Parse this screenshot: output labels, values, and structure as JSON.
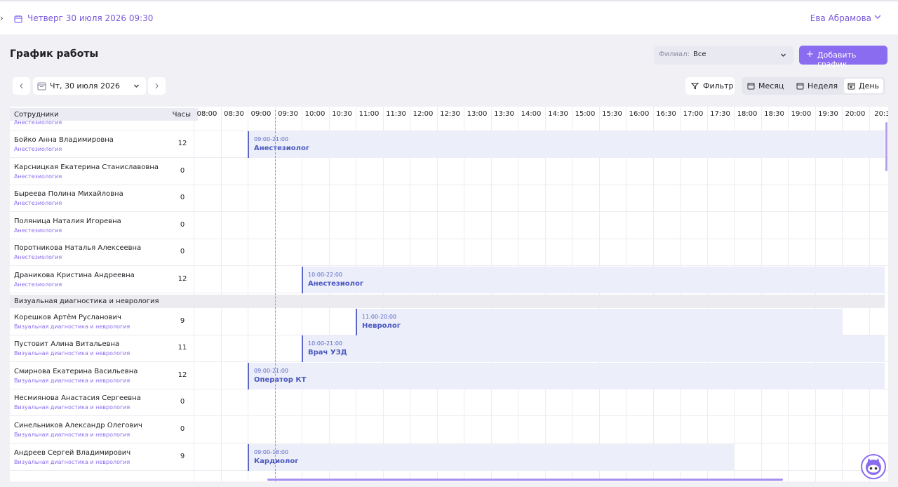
{
  "topbar": {
    "datetime": "Четверг 30 июля 2026 09:30",
    "user": "Ева Абрамова",
    "calendar_icon": "calendar-icon",
    "user_chevron_icon": "chevron-down-icon",
    "expand_icon": "chevron-right-icon"
  },
  "page": {
    "title": "График работы"
  },
  "branch": {
    "label": "Филиал:",
    "value": "Все"
  },
  "add_button": {
    "label": "Добавить график",
    "icon": "plus-icon"
  },
  "date_picker": {
    "value": "Чт, 30 июля 2026"
  },
  "filter": {
    "label": "Фильтр",
    "icon": "filter-icon"
  },
  "views": [
    {
      "label": "Месяц",
      "active": false
    },
    {
      "label": "Неделя",
      "active": false
    },
    {
      "label": "День",
      "active": true
    }
  ],
  "table": {
    "employees_header": "Сотрудники",
    "hours_header": "Часы",
    "partial_dept": "Анестезиология",
    "times": [
      "08:00",
      "08:30",
      "09:00",
      "09:30",
      "10:00",
      "10:30",
      "11:00",
      "11:30",
      "12:00",
      "12:30",
      "13:00",
      "13:30",
      "14:00",
      "14:30",
      "15:00",
      "15:30",
      "16:00",
      "16:30",
      "17:00",
      "17:30",
      "18:00",
      "18:30",
      "19:00",
      "19:30",
      "20:00",
      "20:3"
    ],
    "group1_rows": [
      {
        "name": "Бойко Анна Владимировна",
        "dept": "Анестезиология",
        "hours": "12",
        "shift_time": "09:00-21:00",
        "shift_role": "Анестезиолог",
        "shift_start": "09:00",
        "shift_end": "21:00"
      },
      {
        "name": "Карсницкая Екатерина Станиславовна",
        "dept": "Анестезиология",
        "hours": "0"
      },
      {
        "name": "Быреева Полина Михайловна",
        "dept": "Анестезиология",
        "hours": "0"
      },
      {
        "name": "Поляница Наталия Игоревна",
        "dept": "Анестезиология",
        "hours": "0"
      },
      {
        "name": "Поротникова Наталья Алексеевна",
        "dept": "Анестезиология",
        "hours": "0"
      },
      {
        "name": "Драникова Кристина Андреевна",
        "dept": "Анестезиология",
        "hours": "12",
        "shift_time": "10:00-22:00",
        "shift_role": "Анестезиолог",
        "shift_start": "10:00",
        "shift_end": "22:00"
      }
    ],
    "group2_title": "Визуальная диагностика и неврология",
    "group2_rows": [
      {
        "name": "Корешков Артём Русланович",
        "dept": "Визуальная диагностика и неврология",
        "hours": "9",
        "shift_time": "11:00-20:00",
        "shift_role": "Невролог",
        "shift_start": "11:00",
        "shift_end": "20:00"
      },
      {
        "name": "Пустовит Алина Витальевна",
        "dept": "Визуальная диагностика и неврология",
        "hours": "11",
        "shift_time": "10:00-21:00",
        "shift_role": "Врач УЗД",
        "shift_start": "10:00",
        "shift_end": "21:00"
      },
      {
        "name": "Смирнова Екатерина Васильевна",
        "dept": "Визуальная диагностика и неврология",
        "hours": "12",
        "shift_time": "09:00-21:00",
        "shift_role": "Оператор КТ",
        "shift_start": "09:00",
        "shift_end": "21:00"
      },
      {
        "name": "Несмиянова Анастасия Сергеевна",
        "dept": "Визуальная диагностика и неврология",
        "hours": "0"
      },
      {
        "name": "Синельников Александр Олегович",
        "dept": "Визуальная диагностика и неврология",
        "hours": "0"
      },
      {
        "name": "Андреев Сергей Владимирович",
        "dept": "Визуальная диагностика и неврология",
        "hours": "9",
        "shift_time": "09:00-18:00",
        "shift_role": "Кардиолог",
        "shift_start": "09:00",
        "shift_end": "18:00"
      }
    ],
    "current_time": "09:30"
  },
  "colors": {
    "accent": "#8a6cf0",
    "shift_bg": "#eceef9",
    "shift_border": "#5a67c9"
  },
  "assistant_icon": "cat-assistant-icon"
}
